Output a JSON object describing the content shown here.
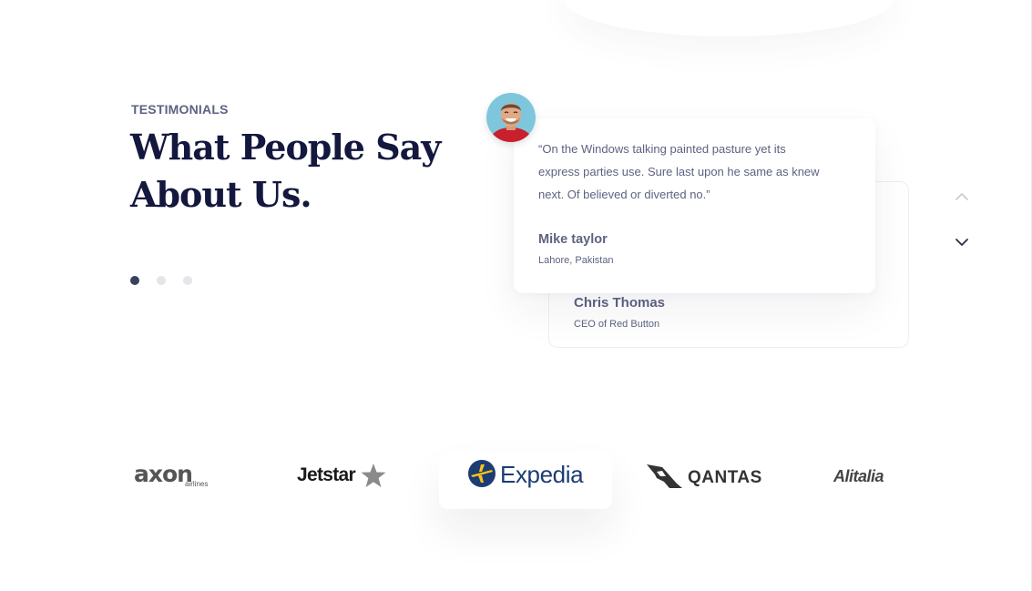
{
  "testimonials": {
    "eyebrow": "TESTIMONIALS",
    "headline_line1": "What People Say",
    "headline_line2": "About Us.",
    "dots": [
      {
        "label": "slide-1",
        "active": true
      },
      {
        "label": "slide-2",
        "active": false
      },
      {
        "label": "slide-3",
        "active": false
      }
    ],
    "active_card": {
      "quote": "“On the Windows talking painted pasture yet its express parties use. Sure last upon he same as knew next. Of believed or diverted no.”",
      "author": "Mike taylor",
      "location": "Lahore, Pakistan",
      "avatar_icon": "person-avatar-icon"
    },
    "back_card": {
      "author": "Chris Thomas",
      "role": "CEO of Red Button"
    },
    "controls": {
      "prev_icon": "chevron-up-icon",
      "next_icon": "chevron-down-icon"
    }
  },
  "partners": {
    "logos": [
      {
        "name": "axon",
        "text": "axon",
        "subtext": "airlines"
      },
      {
        "name": "jetstar",
        "text": "Jetstar",
        "icon": "star-icon"
      },
      {
        "name": "expedia",
        "text": "Expedia",
        "icon": "globe-plane-icon",
        "highlighted": true
      },
      {
        "name": "qantas",
        "text": "QANTAS",
        "icon": "kangaroo-tail-icon"
      },
      {
        "name": "alitalia",
        "text": "Alitalia"
      }
    ]
  },
  "colors": {
    "heading": "#14183e",
    "body_text": "#5e6282",
    "dot_active": "#39425d",
    "dot_inactive": "#e5e5ea",
    "expedia_blue": "#1c3c73",
    "expedia_yellow": "#fcc419"
  }
}
